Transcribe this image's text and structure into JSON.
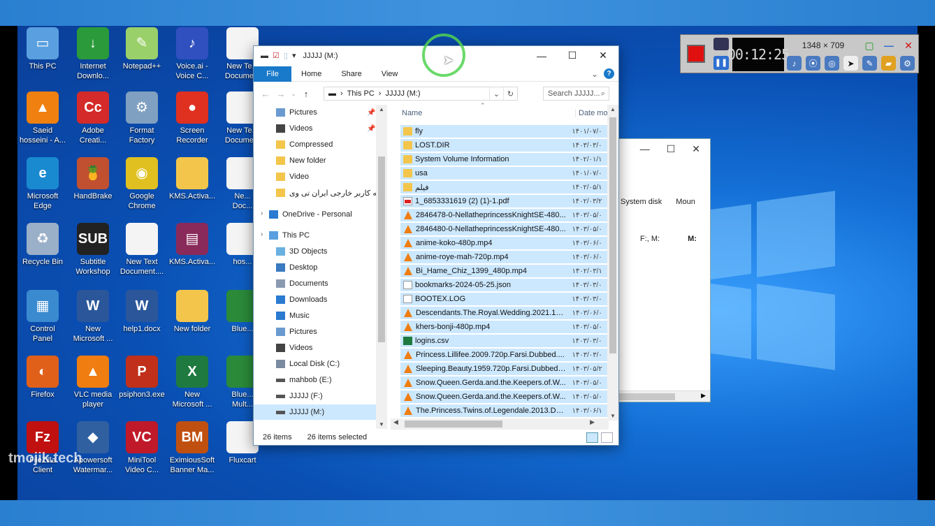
{
  "desktop_icons": [
    {
      "label": "This PC",
      "color": "#5aa0e0",
      "glyph": "▭"
    },
    {
      "label": "Internet\nDownlo...",
      "color": "#2a9a3a",
      "glyph": "↓"
    },
    {
      "label": "Notepad++",
      "color": "#9ad06a",
      "glyph": "✎"
    },
    {
      "label": "Voice.ai -\nVoice C...",
      "color": "#3050c0",
      "glyph": "♪"
    },
    {
      "label": "New Te...\nDocume...",
      "color": "#f4f4f4",
      "glyph": ""
    },
    {
      "label": "Saeid\nhosseini - A...",
      "color": "#f08010",
      "glyph": "▲"
    },
    {
      "label": "Adobe\nCreati...",
      "color": "#d42a2a",
      "glyph": "Cc"
    },
    {
      "label": "Format\nFactory",
      "color": "#7fa0c0",
      "glyph": "⚙"
    },
    {
      "label": "Screen\nRecorder",
      "color": "#e03020",
      "glyph": "●"
    },
    {
      "label": "New Te...\nDocume...",
      "color": "#f4f4f4",
      "glyph": ""
    },
    {
      "label": "Microsoft\nEdge",
      "color": "#1a8ad0",
      "glyph": "e"
    },
    {
      "label": "HandBrake",
      "color": "#c05030",
      "glyph": "🍍"
    },
    {
      "label": "Google\nChrome",
      "color": "#e0c020",
      "glyph": "◉"
    },
    {
      "label": "KMS.Activa...",
      "color": "#f3c64b",
      "glyph": ""
    },
    {
      "label": "Ne...\nDoc...",
      "color": "#f4f4f4",
      "glyph": ""
    },
    {
      "label": "Recycle Bin",
      "color": "#9ab0c8",
      "glyph": "♻"
    },
    {
      "label": "Subtitle\nWorkshop",
      "color": "#222222",
      "glyph": "SUB"
    },
    {
      "label": "New Text\nDocument....",
      "color": "#f4f4f4",
      "glyph": ""
    },
    {
      "label": "KMS.Activa...",
      "color": "#8a2a5a",
      "glyph": "▤"
    },
    {
      "label": "hos...",
      "color": "#f4f4f4",
      "glyph": ""
    },
    {
      "label": "Control\nPanel",
      "color": "#3a8ad0",
      "glyph": "▦"
    },
    {
      "label": "New\nMicrosoft ...",
      "color": "#2b579a",
      "glyph": "W"
    },
    {
      "label": "help1.docx",
      "color": "#2b579a",
      "glyph": "W"
    },
    {
      "label": "New folder",
      "color": "#f3c64b",
      "glyph": ""
    },
    {
      "label": "Blue...",
      "color": "#2a8a3a",
      "glyph": ""
    },
    {
      "label": "Firefox",
      "color": "#e0601a",
      "glyph": "◐"
    },
    {
      "label": "VLC media\nplayer",
      "color": "#f07d10",
      "glyph": "▲"
    },
    {
      "label": "psiphon3.exe",
      "color": "#c0301a",
      "glyph": "P"
    },
    {
      "label": "New\nMicrosoft ...",
      "color": "#1f7a3f",
      "glyph": "X"
    },
    {
      "label": "Blue...\nMult...",
      "color": "#2a8a3a",
      "glyph": ""
    },
    {
      "label": "FileZilla\nClient",
      "color": "#c01010",
      "glyph": "Fz"
    },
    {
      "label": "Apowersoft\nWatermar...",
      "color": "#3060a0",
      "glyph": "◆"
    },
    {
      "label": "MiniTool\nVideo C...",
      "color": "#c01a2a",
      "glyph": "VC"
    },
    {
      "label": "EximiousSoft\nBanner Ma...",
      "color": "#c05010",
      "glyph": "BM"
    },
    {
      "label": "Fluxcart",
      "color": "#f4f4f4",
      "glyph": ""
    }
  ],
  "watermark": "tmojik.tech",
  "bg_window": {
    "columns": [
      "System disk",
      "Moun"
    ],
    "row": [
      "F:, M:",
      "M:"
    ]
  },
  "explorer": {
    "title": "JJJJJ (M:)",
    "ribbon": {
      "file": "File",
      "tabs": [
        "Home",
        "Share",
        "View"
      ]
    },
    "address": {
      "crumbs": [
        "This PC",
        "JJJJJ (M:)"
      ]
    },
    "search_placeholder": "Search JJJJJ...",
    "nav_items": [
      {
        "label": "Pictures",
        "kind": "pictures",
        "pinned": true
      },
      {
        "label": "Videos",
        "kind": "videos",
        "pinned": true
      },
      {
        "label": "Compressed",
        "kind": "folder",
        "pinned": false
      },
      {
        "label": "New folder",
        "kind": "folder",
        "pinned": false
      },
      {
        "label": "Video",
        "kind": "folder",
        "pinned": false
      },
      {
        "label": "به کاربر خارجی ایران تی وی",
        "kind": "folder",
        "pinned": false
      },
      {
        "label": "OneDrive - Personal",
        "kind": "onedrive",
        "pinned": false
      },
      {
        "label": "This PC",
        "kind": "pc",
        "pinned": false
      },
      {
        "label": "3D Objects",
        "kind": "objects",
        "pinned": false
      },
      {
        "label": "Desktop",
        "kind": "desktop",
        "pinned": false
      },
      {
        "label": "Documents",
        "kind": "docs",
        "pinned": false
      },
      {
        "label": "Downloads",
        "kind": "downloads",
        "pinned": false
      },
      {
        "label": "Music",
        "kind": "music",
        "pinned": false
      },
      {
        "label": "Pictures",
        "kind": "pictures",
        "pinned": false
      },
      {
        "label": "Videos",
        "kind": "videos",
        "pinned": false
      },
      {
        "label": "Local Disk (C:)",
        "kind": "drive",
        "pinned": false
      },
      {
        "label": "mahbob (E:)",
        "kind": "drive2",
        "pinned": false
      },
      {
        "label": "JJJJJ (F:)",
        "kind": "drive2",
        "pinned": false
      },
      {
        "label": "JJJJJ (M:)",
        "kind": "drive2",
        "pinned": false
      }
    ],
    "columns": {
      "name": "Name",
      "date": "Date mo..."
    },
    "files": [
      {
        "name": "fly",
        "type": "folder",
        "date": "۱۴۰۱/۰۷/۰"
      },
      {
        "name": "LOST.DIR",
        "type": "folder",
        "date": "۱۴۰۳/۰۳/۰"
      },
      {
        "name": "System Volume Information",
        "type": "folder",
        "date": "۱۴۰۲/۰۱/۱"
      },
      {
        "name": "usa",
        "type": "folder",
        "date": "۱۴۰۱/۰۷/۰"
      },
      {
        "name": "فیلم",
        "type": "folder",
        "date": "۱۴۰۲/۰۵/۱"
      },
      {
        "name": "1_6853331619 (2) (1)-1.pdf",
        "type": "pdf",
        "date": "۱۴۰۲/۰۳/۲"
      },
      {
        "name": "2846478-0-NellatheprincessKnightSE-480...",
        "type": "vlc",
        "date": "۱۴۰۳/۰۵/۰"
      },
      {
        "name": "2846480-0-NellatheprincessKnightSE-480...",
        "type": "vlc",
        "date": "۱۴۰۳/۰۵/۰"
      },
      {
        "name": "anime-koko-480p.mp4",
        "type": "vlc",
        "date": "۱۴۰۳/۰۶/۰"
      },
      {
        "name": "anime-roye-mah-720p.mp4",
        "type": "vlc",
        "date": "۱۴۰۳/۰۶/۰"
      },
      {
        "name": "Bi_Hame_Chiz_1399_480p.mp4",
        "type": "vlc",
        "date": "۱۴۰۲/۰۳/۱"
      },
      {
        "name": "bookmarks-2024-05-25.json",
        "type": "txt",
        "date": "۱۴۰۳/۰۳/۰"
      },
      {
        "name": "BOOTEX.LOG",
        "type": "txt",
        "date": "۱۴۰۳/۰۳/۰"
      },
      {
        "name": "Descendants.The.Royal.Wedding.2021.10...",
        "type": "vlc",
        "date": "۱۴۰۳/۰۶/۰"
      },
      {
        "name": "khers-bonji-480p.mp4",
        "type": "vlc",
        "date": "۱۴۰۳/۰۵/۰"
      },
      {
        "name": "logins.csv",
        "type": "csv",
        "date": "۱۴۰۳/۰۳/۰"
      },
      {
        "name": "Princess.Lillifee.2009.720p.Farsi.Dubbed....",
        "type": "vlc",
        "date": "۱۴۰۳/۰۳/۰"
      },
      {
        "name": "Sleeping.Beauty.1959.720p.Farsi.Dubbed....",
        "type": "vlc",
        "date": "۱۴۰۳/۰۵/۲"
      },
      {
        "name": "Snow.Queen.Gerda.and.the.Keepers.of.W...",
        "type": "vlc",
        "date": "۱۴۰۳/۰۵/۰"
      },
      {
        "name": "Snow.Queen.Gerda.and.the.Keepers.of.W...",
        "type": "vlc",
        "date": "۱۴۰۳/۰۵/۰"
      },
      {
        "name": "The.Princess.Twins.of.Legendale.2013.DV...",
        "type": "vlc",
        "date": "۱۴۰۳/۰۶/۱"
      }
    ],
    "status": {
      "count": "26 items",
      "selected": "26 items selected"
    }
  },
  "recorder": {
    "timer": "00:12:25",
    "dimensions": "1348 × 709"
  },
  "colors": {
    "accent": "#1979ca",
    "selection": "#cce8ff"
  }
}
